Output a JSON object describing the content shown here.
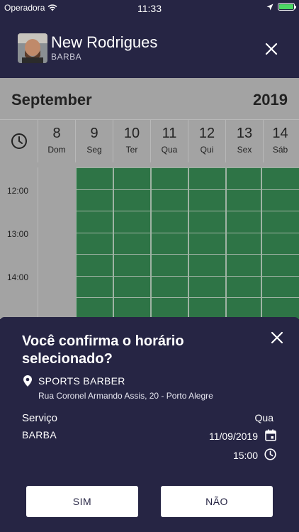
{
  "status_bar": {
    "carrier": "Operadora",
    "time": "11:33"
  },
  "header": {
    "name": "New Rodrigues",
    "service": "BARBA"
  },
  "calendar": {
    "month": "September",
    "year": "2019",
    "days": [
      {
        "num": "8",
        "weekday": "Dom"
      },
      {
        "num": "9",
        "weekday": "Seg"
      },
      {
        "num": "10",
        "weekday": "Ter"
      },
      {
        "num": "11",
        "weekday": "Qua"
      },
      {
        "num": "12",
        "weekday": "Qui"
      },
      {
        "num": "13",
        "weekday": "Sex"
      },
      {
        "num": "14",
        "weekday": "Sáb"
      }
    ],
    "hours": [
      "12:00",
      "13:00",
      "14:00"
    ]
  },
  "modal": {
    "title": "Você confirma o horário selecionado?",
    "shop_name": "SPORTS BARBER",
    "address": "Rua Coronel Armando Assis, 20 - Porto Alegre",
    "service_label": "Serviço",
    "service_value": "BARBA",
    "weekday": "Qua",
    "date": "11/09/2019",
    "time": "15:00",
    "confirm_label": "SIM",
    "cancel_label": "NÃO"
  },
  "colors": {
    "header_bg": "#262544",
    "slot_green": "#2e7446",
    "calendar_bg": "#a3a3a3"
  }
}
